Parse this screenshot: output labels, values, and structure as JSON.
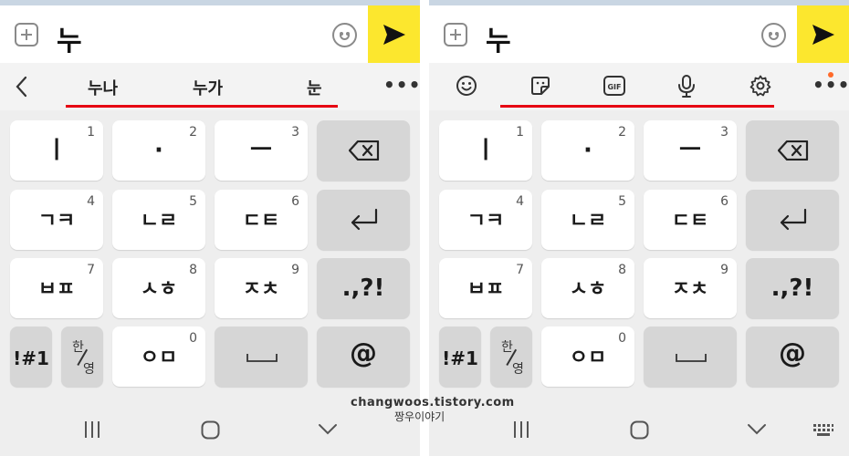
{
  "input": {
    "typed_text": "누"
  },
  "left_toolbar": {
    "back_icon": "chevron-left-icon",
    "suggestions": [
      "누나",
      "누가",
      "눈"
    ],
    "more_icon": "more-icon",
    "highlight_color": "#e60012"
  },
  "right_toolbar": {
    "icons": [
      "emoji-icon",
      "sticker-icon",
      "gif-icon",
      "mic-icon",
      "settings-icon"
    ],
    "gif_label": "GIF",
    "more_icon": "more-icon",
    "badge_color": "#ff6a2a"
  },
  "keys": {
    "k1": {
      "label": "ㅣ",
      "num": "1"
    },
    "k2": {
      "label": "·",
      "num": "2"
    },
    "k3": {
      "label": "ㅡ",
      "num": "3"
    },
    "k4": {
      "label": "ㄱㅋ",
      "num": "4"
    },
    "k5": {
      "label": "ㄴㄹ",
      "num": "5"
    },
    "k6": {
      "label": "ㄷㅌ",
      "num": "6"
    },
    "k7": {
      "label": "ㅂㅍ",
      "num": "7"
    },
    "k8": {
      "label": "ㅅㅎ",
      "num": "8"
    },
    "k9": {
      "label": "ㅈㅊ",
      "num": "9"
    },
    "k0": {
      "label": "ㅇㅁ",
      "num": "0"
    },
    "punct": ".,?!",
    "symbols": "!#1",
    "han": "한",
    "yeong": "영",
    "at": "@"
  },
  "colors": {
    "send_button": "#fce72e",
    "key_bg": "#ffffff",
    "func_key_bg": "#d6d6d6"
  },
  "watermark": {
    "line1": "changwoos.tistory.com",
    "line2": "짱우이야기"
  }
}
